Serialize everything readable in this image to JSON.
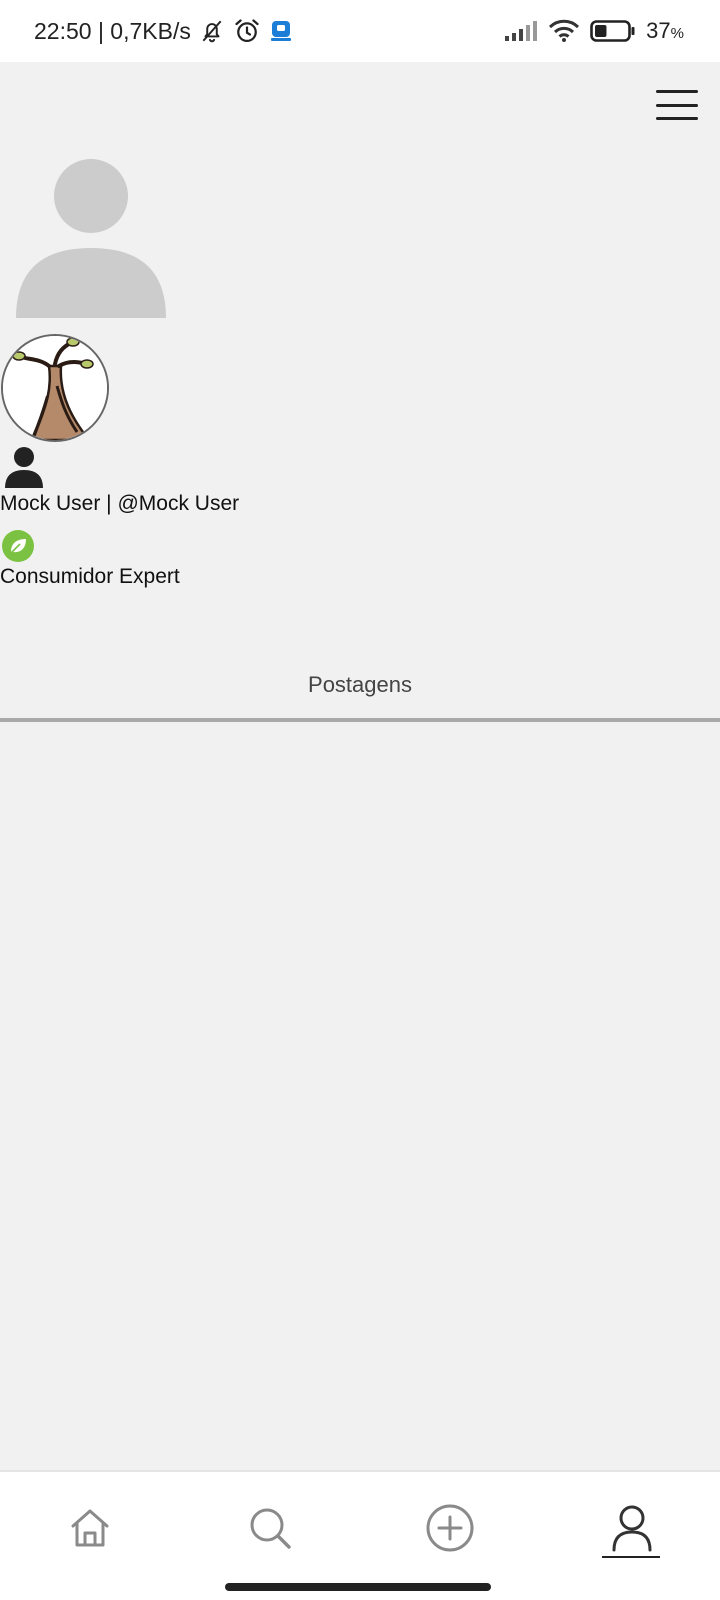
{
  "status_bar": {
    "time_speed": "22:50 | 0,7KB/s",
    "battery_percent": "37",
    "battery_unit": "%",
    "battery_level": 0.37,
    "icons": [
      "muted-bell-icon",
      "alarm-icon",
      "app-notification-icon",
      "signal-icon",
      "wifi-icon",
      "battery-icon"
    ]
  },
  "header": {
    "menu_icon": "hamburger-menu-icon"
  },
  "profile": {
    "user_line": "Mock User | @Mock User",
    "level": "Consumidor Expert",
    "badge_icon": "leaf-badge-icon",
    "badge_color": "#7cc242"
  },
  "tabs": [
    {
      "label": "Postagens",
      "active": true
    }
  ],
  "bottom_nav": {
    "items": [
      {
        "icon": "home-icon"
      },
      {
        "icon": "search-icon"
      },
      {
        "icon": "add-circle-icon"
      },
      {
        "icon": "profile-icon",
        "active": true
      }
    ]
  },
  "colors": {
    "background": "#f1f1f1",
    "placeholder": "#cccccc",
    "divider": "#aaaaaa"
  }
}
